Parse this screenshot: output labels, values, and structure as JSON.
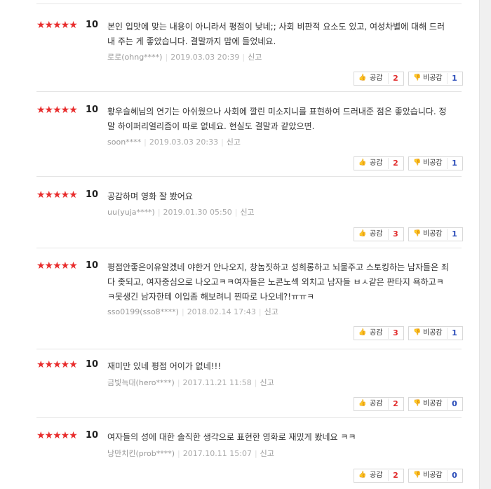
{
  "reviews": [
    {
      "stars": "★★★★★",
      "score": "10",
      "text": "본인 입맛에 맞는 내용이 아니라서 평점이 낮네;; 사회 비판적 요소도 있고, 여성차별에 대해 드러내 주는 게 좋았습니다. 결말까지 맘에 들었네요.",
      "author": "로로(ohng****)",
      "date": "2019.03.03 20:39",
      "report": "신고",
      "sympathy_label": "공감",
      "sympathy_count": "2",
      "antipathy_label": "비공감",
      "antipathy_count": "1"
    },
    {
      "stars": "★★★★★",
      "score": "10",
      "text": "황우슬혜님의 연기는 아쉬웠으나 사회에 깔린 미소지니를 표현하여 드러내준 점은 좋았습니다. 정말 하이퍼리얼리즘이 따로 없네요. 현실도 결말과 같았으면.",
      "author": "soon****",
      "date": "2019.03.03 20:33",
      "report": "신고",
      "sympathy_label": "공감",
      "sympathy_count": "2",
      "antipathy_label": "비공감",
      "antipathy_count": "1"
    },
    {
      "stars": "★★★★★",
      "score": "10",
      "text": "공감하며 영화 잘 봤어요",
      "author": "uu(yuja****)",
      "date": "2019.01.30 05:50",
      "report": "신고",
      "sympathy_label": "공감",
      "sympathy_count": "3",
      "antipathy_label": "비공감",
      "antipathy_count": "1"
    },
    {
      "stars": "★★★★★",
      "score": "10",
      "text": "평점안좋은이유알겠네 야한거 안나오지, 창놈짓하고 성희롱하고 뇌물주고 스토킹하는 남자들은 죄다 좆되고, 여자중심으로 나오고ㅋㅋ여자들은 노콘노섹 외치고 남자들 ㅂㅅ같은 판타지 욕하고ㅋㅋ못생긴 남자한테 이입좀 해보려니 찐따로 나오네?!ㅠㅠㅋ",
      "author": "sso0199(sso8****)",
      "date": "2018.02.14 17:43",
      "report": "신고",
      "sympathy_label": "공감",
      "sympathy_count": "3",
      "antipathy_label": "비공감",
      "antipathy_count": "1"
    },
    {
      "stars": "★★★★★",
      "score": "10",
      "text": "재미만 있네 평점 어이가 없네!!!",
      "author": "금빛늑대(hero****)",
      "date": "2017.11.21 11:58",
      "report": "신고",
      "sympathy_label": "공감",
      "sympathy_count": "2",
      "antipathy_label": "비공감",
      "antipathy_count": "0"
    },
    {
      "stars": "★★★★★",
      "score": "10",
      "text": "여자들의 성에 대한 솔직한 생각으로 표현한 영화로 재밌게 봤네요 ㅋㅋ",
      "author": "낭만치킨(prob****)",
      "date": "2017.10.11 15:07",
      "report": "신고",
      "sympathy_label": "공감",
      "sympathy_count": "2",
      "antipathy_label": "비공감",
      "antipathy_count": "0"
    }
  ]
}
